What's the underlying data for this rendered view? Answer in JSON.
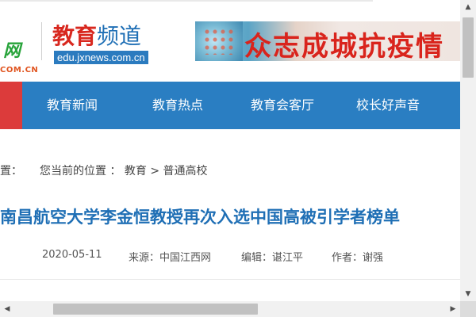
{
  "header": {
    "site_logo_char": "网",
    "site_logo_domain": "COM.CN",
    "channel_title_red": "教育",
    "channel_title_blue": "频道",
    "channel_url": "edu.jxnews.com.cn",
    "banner_text": "众志成城抗疫情"
  },
  "nav": {
    "items": [
      {
        "label": "教育新闻"
      },
      {
        "label": "教育热点"
      },
      {
        "label": "教育会客厅"
      },
      {
        "label": "校长好声音"
      }
    ],
    "colors": {
      "bar": "#2a7ec2",
      "left_accent": "#dc3b3b"
    }
  },
  "breadcrumb": {
    "prefix": "置：",
    "current_label": "您当前的位置",
    "sep1": "：",
    "level1": "教育",
    "sep2": ">",
    "level2": "普通高校"
  },
  "article": {
    "title": "南昌航空大学李金恒教授再次入选中国高被引学者榜单",
    "date": "2020-05-11",
    "source": "来源：中国江西网",
    "editor": "编辑：谌江平",
    "author": "作者：谢强"
  },
  "colors": {
    "title": "#1f6fb5",
    "brand_red": "#d8281f"
  }
}
